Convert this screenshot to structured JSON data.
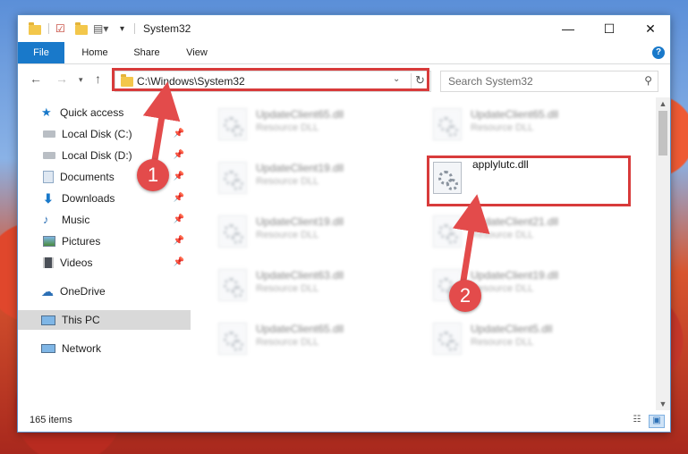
{
  "window": {
    "title": "System32",
    "controls": {
      "minimize": "—",
      "maximize": "☐",
      "close": "✕"
    }
  },
  "ribbon": {
    "tabs": [
      {
        "label": "File"
      },
      {
        "label": "Home"
      },
      {
        "label": "Share"
      },
      {
        "label": "View"
      }
    ],
    "help": "?"
  },
  "address": {
    "path": "C:\\Windows\\System32",
    "search_placeholder": "Search System32"
  },
  "sidebar": {
    "items": [
      {
        "label": "Quick access",
        "icon": "star-icon"
      },
      {
        "label": "Local Disk (C:)",
        "icon": "drive-icon",
        "pinned": true
      },
      {
        "label": "Local Disk (D:)",
        "icon": "drive-icon",
        "pinned": true
      },
      {
        "label": "Documents",
        "icon": "documents-icon",
        "pinned": true
      },
      {
        "label": "Downloads",
        "icon": "download-icon",
        "pinned": true
      },
      {
        "label": "Music",
        "icon": "music-icon",
        "pinned": true
      },
      {
        "label": "Pictures",
        "icon": "pictures-icon",
        "pinned": true
      },
      {
        "label": "Videos",
        "icon": "videos-icon",
        "pinned": true
      },
      {
        "label": "OneDrive",
        "icon": "cloud-icon"
      },
      {
        "label": "This PC",
        "icon": "computer-icon",
        "selected": true
      },
      {
        "label": "Network",
        "icon": "network-icon"
      }
    ]
  },
  "files": [
    {
      "name": "UpdateClient65.dll",
      "type": "Resource DLL"
    },
    {
      "name": "UpdateClient65.dll",
      "type": "Resource DLL"
    },
    {
      "name": "UpdateClient19.dll",
      "type": "Resource DLL"
    },
    {
      "name": "applylutc.dll",
      "type": ""
    },
    {
      "name": "UpdateClient19.dll",
      "type": "Resource DLL"
    },
    {
      "name": "UpdateClient21.dll",
      "type": "Resource DLL"
    },
    {
      "name": "UpdateClient63.dll",
      "type": "Resource DLL"
    },
    {
      "name": "UpdateClient19.dll",
      "type": "Resource DLL"
    },
    {
      "name": "UpdateClient65.dll",
      "type": "Resource DLL"
    },
    {
      "name": "UpdateClient5.dll",
      "type": "Resource DLL"
    }
  ],
  "status": {
    "item_count": "165 items"
  },
  "callouts": {
    "step1": "1",
    "step2": "2"
  },
  "colors": {
    "accent": "#1979ca",
    "highlight": "#d83b3b",
    "callout": "#e34b4b"
  }
}
